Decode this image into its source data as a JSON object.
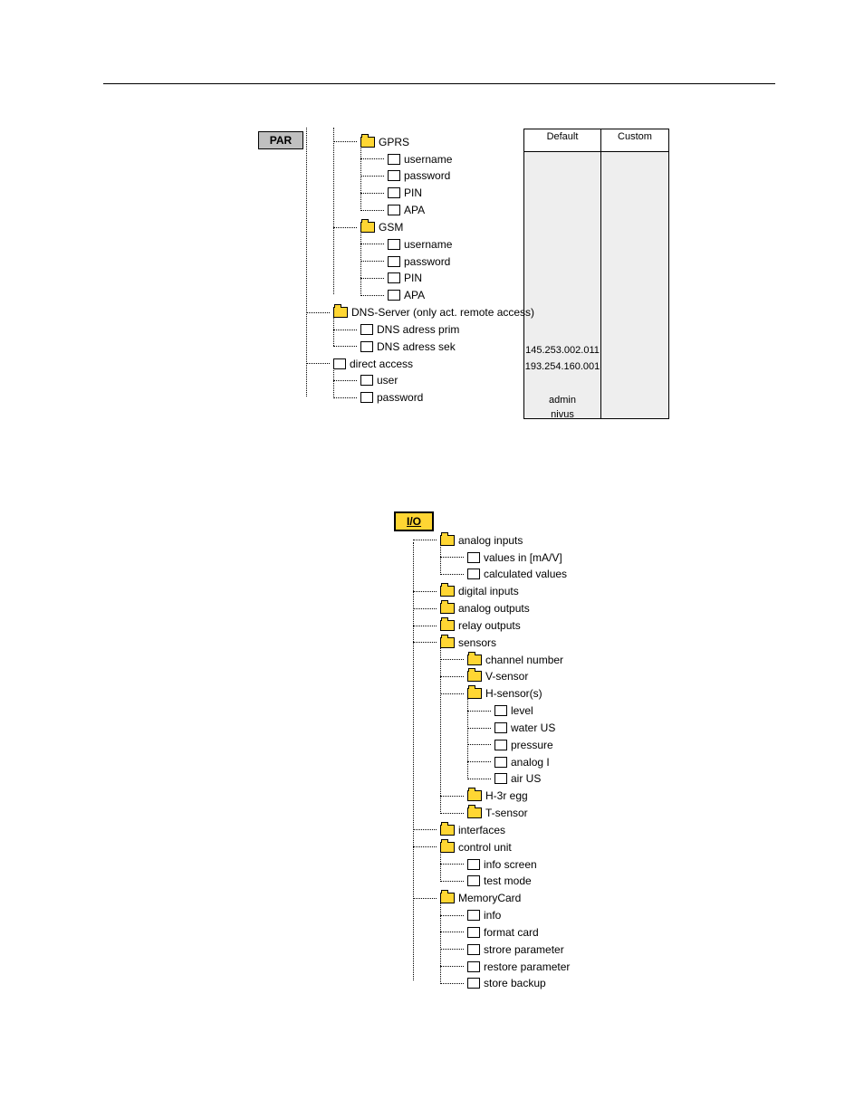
{
  "section_par": {
    "title": "PAR",
    "table": {
      "headers": [
        "Default",
        "Custom"
      ],
      "values": {
        "dns_prim": "145.253.002.011",
        "dns_sek": "193.254.160.001",
        "user": "admin",
        "password": "nivus"
      }
    },
    "tree": [
      {
        "type": "folder",
        "label": "GPRS",
        "children": [
          {
            "type": "file",
            "label": "username"
          },
          {
            "type": "file",
            "label": "password"
          },
          {
            "type": "file",
            "label": "PIN"
          },
          {
            "type": "file",
            "label": "APA"
          }
        ]
      },
      {
        "type": "folder",
        "label": "GSM",
        "children": [
          {
            "type": "file",
            "label": "username"
          },
          {
            "type": "file",
            "label": "password"
          },
          {
            "type": "file",
            "label": "PIN"
          },
          {
            "type": "file",
            "label": "APA"
          }
        ]
      },
      {
        "type": "folder",
        "label": "DNS-Server (only act. remote access)",
        "children": [
          {
            "type": "file",
            "label": "DNS adress prim"
          },
          {
            "type": "file",
            "label": "DNS adress sek"
          }
        ]
      },
      {
        "type": "file",
        "label": "direct access",
        "children": [
          {
            "type": "file",
            "label": "user"
          },
          {
            "type": "file",
            "label": "password"
          }
        ]
      }
    ]
  },
  "section_io": {
    "title": "I/O",
    "tree": [
      {
        "type": "folder",
        "label": "analog inputs",
        "children": [
          {
            "type": "file",
            "label": "values in [mA/V]"
          },
          {
            "type": "file",
            "label": "calculated values"
          }
        ]
      },
      {
        "type": "folder",
        "label": "digital inputs"
      },
      {
        "type": "folder",
        "label": "analog outputs"
      },
      {
        "type": "folder",
        "label": "relay outputs"
      },
      {
        "type": "folder",
        "label": "sensors",
        "children": [
          {
            "type": "folder",
            "label": "channel number"
          },
          {
            "type": "folder",
            "label": "V-sensor"
          },
          {
            "type": "folder",
            "label": "H-sensor(s)",
            "children": [
              {
                "type": "file",
                "label": "level"
              },
              {
                "type": "file",
                "label": "water US"
              },
              {
                "type": "file",
                "label": "pressure"
              },
              {
                "type": "file",
                "label": "analog I"
              },
              {
                "type": "file",
                "label": "air US"
              }
            ]
          },
          {
            "type": "folder",
            "label": "H-3r egg"
          },
          {
            "type": "folder",
            "label": "T-sensor"
          }
        ]
      },
      {
        "type": "folder",
        "label": "interfaces"
      },
      {
        "type": "folder",
        "label": "control unit",
        "children": [
          {
            "type": "file",
            "label": "info screen"
          },
          {
            "type": "file",
            "label": "test mode"
          }
        ]
      },
      {
        "type": "folder",
        "label": "MemoryCard",
        "children": [
          {
            "type": "file",
            "label": "info"
          },
          {
            "type": "file",
            "label": "format card"
          },
          {
            "type": "file",
            "label": "strore parameter"
          },
          {
            "type": "file",
            "label": "restore parameter"
          },
          {
            "type": "file",
            "label": "store backup"
          }
        ]
      }
    ]
  }
}
